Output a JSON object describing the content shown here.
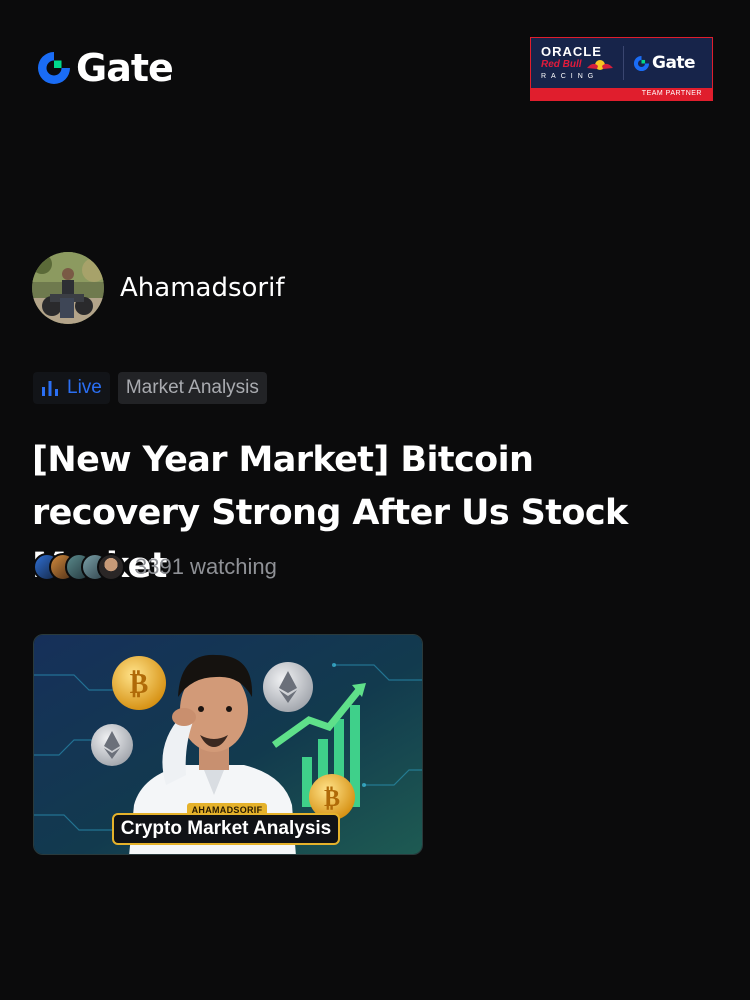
{
  "header": {
    "logo_text": "Gate",
    "brand_color": "#1a6cf5",
    "accent_color": "#00d98b"
  },
  "partner_banner": {
    "line1": "ORACLE",
    "line2": "Red Bull",
    "line3": "RACING",
    "gate_text": "Gate",
    "strip_text": "TEAM PARTNER"
  },
  "author": {
    "name": "Ahamadsorif"
  },
  "tags": {
    "live_label": "Live",
    "live_icon": "bar-chart-icon",
    "category_label": "Market Analysis"
  },
  "post": {
    "title": "[New Year Market] Bitcoin recovery Strong After Us Stock Market",
    "watching_text": "3391 watching"
  },
  "thumbnail": {
    "badge_top": "AHAMADSORIF",
    "badge_main": "Crypto Market Analysis"
  }
}
